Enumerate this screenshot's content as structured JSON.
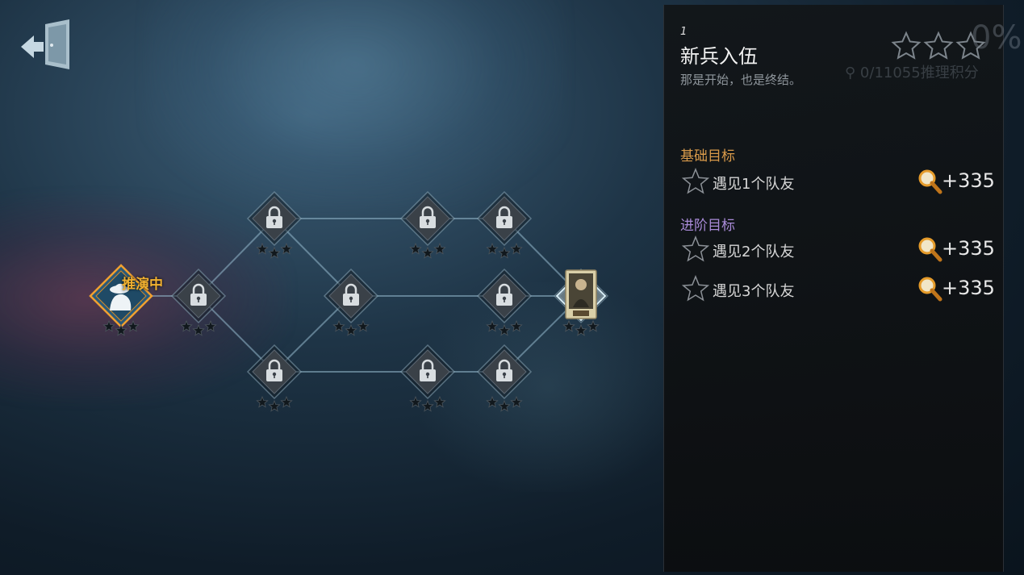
{
  "exit_icon": "exit-door-icon",
  "map": {
    "current_node_label": "推演中",
    "nodes": [
      {
        "id": "n0",
        "state": "current",
        "icon": "detective-silhouette-icon",
        "stars_earned": 0
      },
      {
        "id": "n1",
        "state": "locked",
        "icon": "padlock-icon",
        "stars_earned": 0
      },
      {
        "id": "n2",
        "state": "locked",
        "icon": "padlock-icon",
        "stars_earned": 0
      },
      {
        "id": "n3",
        "state": "locked",
        "icon": "padlock-icon",
        "stars_earned": 0
      },
      {
        "id": "n4",
        "state": "locked",
        "icon": "padlock-icon",
        "stars_earned": 0
      },
      {
        "id": "n5",
        "state": "locked",
        "icon": "padlock-icon",
        "stars_earned": 0
      },
      {
        "id": "n6",
        "state": "locked",
        "icon": "padlock-icon",
        "stars_earned": 0
      },
      {
        "id": "n7",
        "state": "locked",
        "icon": "padlock-icon",
        "stars_earned": 0
      },
      {
        "id": "n8",
        "state": "locked",
        "icon": "padlock-icon",
        "stars_earned": 0
      },
      {
        "id": "n9",
        "state": "locked",
        "icon": "padlock-icon",
        "stars_earned": 0
      },
      {
        "id": "n10",
        "state": "locked",
        "icon": "padlock-icon",
        "stars_earned": 0
      },
      {
        "id": "n11",
        "state": "portrait",
        "icon": "character-portrait-card",
        "stars_earned": 0
      }
    ]
  },
  "panel": {
    "chapter_number": "1",
    "title": "新兵入伍",
    "subtitle": "那是开始，也是终结。",
    "progress_percent": "0%",
    "score_text": "0/11055推理积分",
    "stars_earned": 0,
    "basic_goals_label": "基础目标",
    "advanced_goals_label": "进阶目标",
    "basic_goals": [
      {
        "text": "遇见1个队友",
        "reward": "+335",
        "reward_icon": "magnifier-icon"
      }
    ],
    "advanced_goals": [
      {
        "text": "遇见2个队友",
        "reward": "+335",
        "reward_icon": "magnifier-icon"
      },
      {
        "text": "遇见3个队友",
        "reward": "+335",
        "reward_icon": "magnifier-icon"
      }
    ]
  },
  "colors": {
    "current_accent": "#f0a030",
    "basic_label": "#d99a4a",
    "advanced_label": "#a98bd8",
    "locked_node": "#3a4148"
  }
}
